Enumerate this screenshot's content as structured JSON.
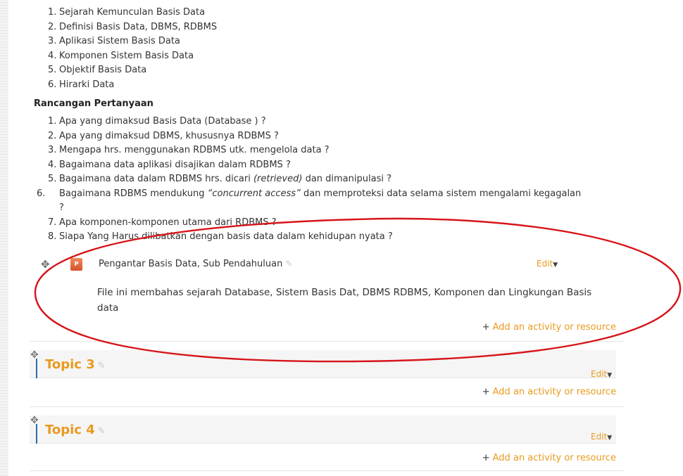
{
  "section_topics": [
    {
      "num": "1.",
      "text": "Sejarah Kemunculan Basis Data"
    },
    {
      "num": "2.",
      "text": "Definisi Basis Data, DBMS, RDBMS"
    },
    {
      "num": "3.",
      "text": "Aplikasi Sistem Basis Data"
    },
    {
      "num": "4.",
      "text": "Komponen Sistem Basis Data"
    },
    {
      "num": "5.",
      "text": "Objektif Basis Data"
    },
    {
      "num": "6.",
      "text": "Hirarki Data"
    }
  ],
  "questions_heading": "Rancangan  Pertanyaan",
  "questions": [
    {
      "num": "1.",
      "text": "Apa yang dimaksud Basis Data (Database ) ?"
    },
    {
      "num": "2.",
      "text": "Apa yang dimaksud DBMS, khususnya RDBMS ?"
    },
    {
      "num": "3.",
      "text": "Mengapa hrs. menggunakan RDBMS utk. mengelola data ?"
    },
    {
      "num": "4.",
      "text": "Bagaimana data aplikasi disajikan dalam RDBMS ?"
    },
    {
      "num": "5.",
      "text_before": "Bagaimana data dalam RDBMS hrs. dicari ",
      "em": "(retrieved)",
      "text_after": " dan dimanipulasi ?"
    },
    {
      "num": "6.",
      "text_before": "Bagaimana RDBMS mendukung ",
      "em": "“concurrent access”",
      "text_after": " dan memproteksi data selama sistem mengalami kegagalan ?"
    },
    {
      "num": "7.",
      "text": "Apa komponen-komponen utama dari RDBMS ?"
    },
    {
      "num": "8.",
      "text": "Siapa Yang Harus dilibatkan dengan basis data dalam kehidupan nyata ?"
    }
  ],
  "resource": {
    "icon": "powerpoint-file-icon",
    "icon_label": "P",
    "title": "Pengantar Basis Data, Sub Pendahuluan",
    "description": "File ini membahas sejarah Database, Sistem Basis Dat, DBMS RDBMS, Komponen dan Lingkungan Basis data"
  },
  "edit_label": "Edit",
  "add_activity_label": "Add an activity or resource",
  "topics": [
    {
      "title": "Topic 3"
    },
    {
      "title": "Topic 4"
    }
  ],
  "colors": {
    "accent": "#e89a1f",
    "annotation_ellipse": "#d7141a",
    "topic_bar": "#2b6ea8"
  }
}
